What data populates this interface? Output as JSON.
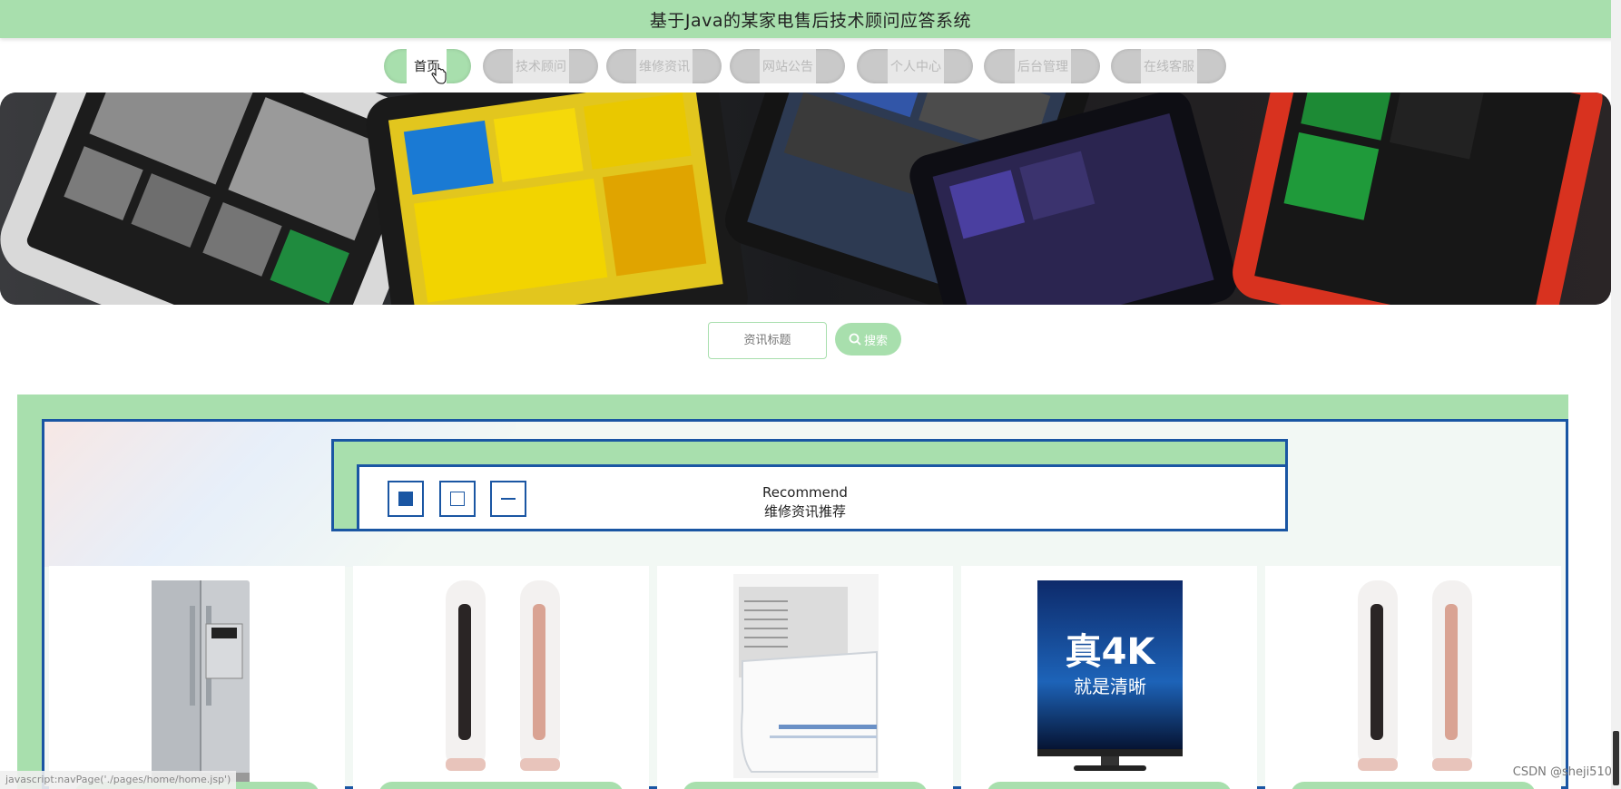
{
  "header": {
    "title": "基于Java的某家电售后技术顾问应答系统"
  },
  "nav": {
    "items": [
      {
        "label": "首页",
        "active": true
      },
      {
        "label": "技术顾问",
        "active": false
      },
      {
        "label": "维修资讯",
        "active": false
      },
      {
        "label": "网站公告",
        "active": false
      },
      {
        "label": "个人中心",
        "active": false
      },
      {
        "label": "后台管理",
        "active": false
      },
      {
        "label": "在线客服",
        "active": false
      }
    ]
  },
  "search": {
    "placeholder": "资讯标题",
    "button_label": "搜索"
  },
  "recommend": {
    "title_en": "Recommend",
    "title_cn": "维修资讯推荐"
  },
  "products": [
    {
      "name": "refrigerator"
    },
    {
      "name": "floor-air-conditioner"
    },
    {
      "name": "wall-air-conditioner"
    },
    {
      "name": "4k-tv",
      "text_line1": "真4K",
      "text_line2": "就是清晰"
    },
    {
      "name": "floor-air-conditioner"
    }
  ],
  "statusbar": {
    "url": "javascript:navPage('./pages/home/home.jsp')"
  },
  "watermark": {
    "text": "CSDN @sheji510"
  },
  "colors": {
    "accent": "#a8dfad",
    "frame": "#1a56a3"
  }
}
